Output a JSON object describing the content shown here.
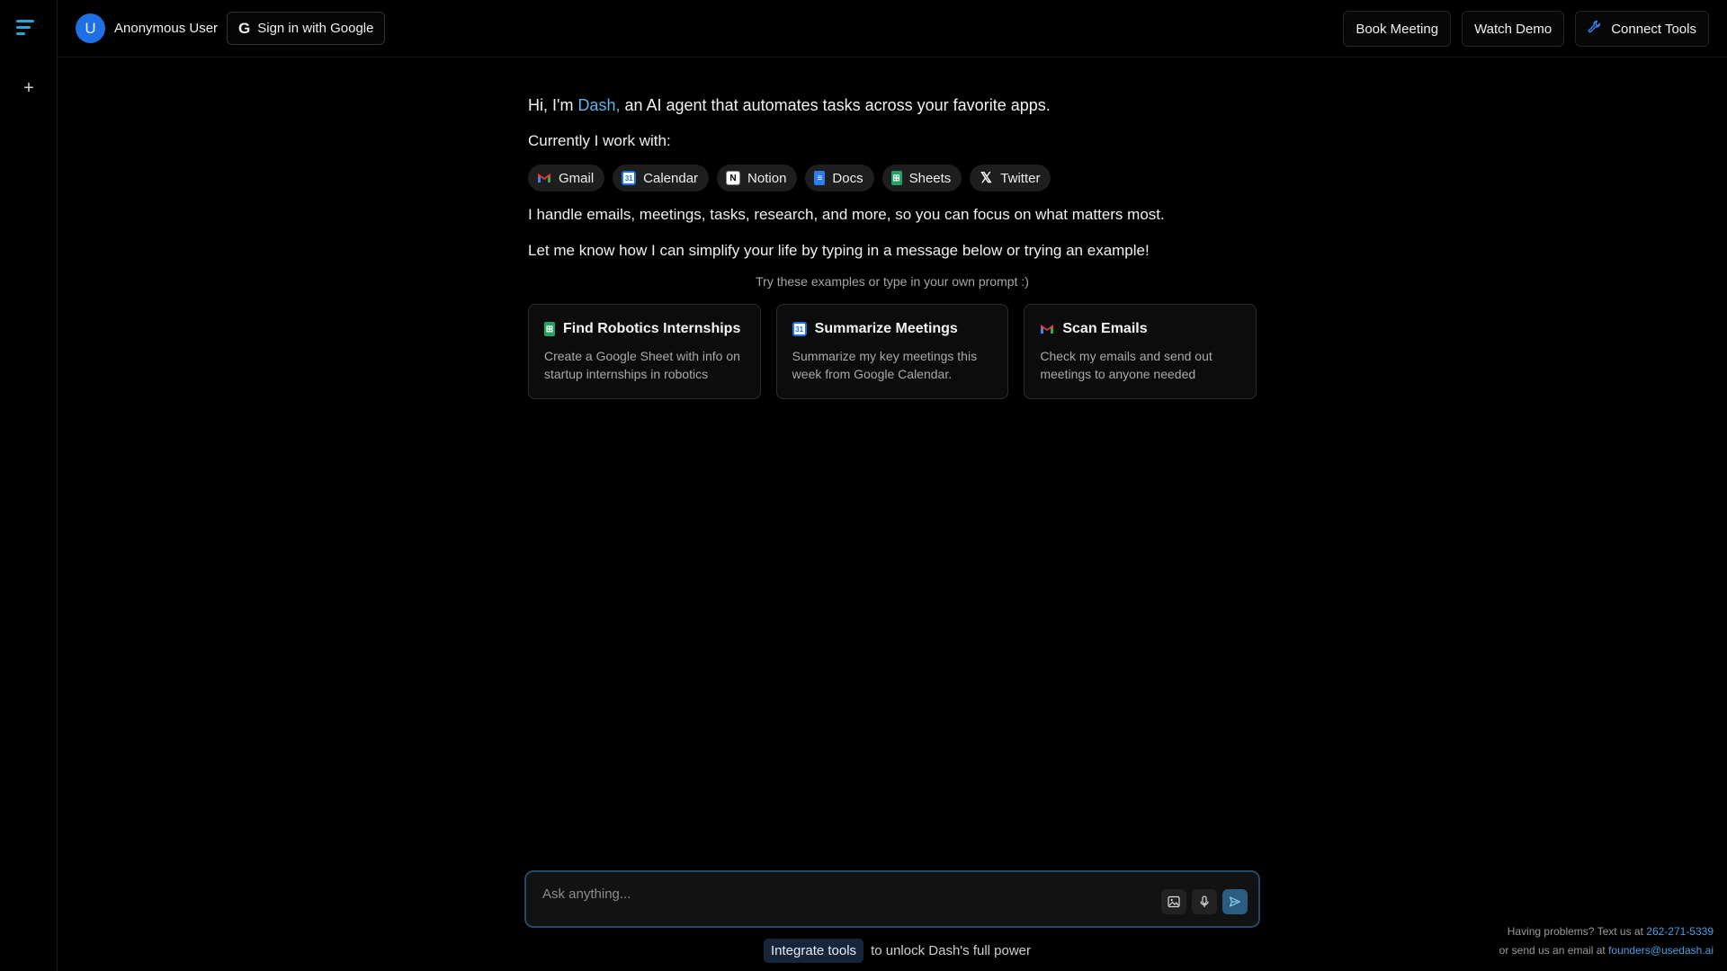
{
  "rail": {
    "plus": "+"
  },
  "user": {
    "initial": "U",
    "name": "Anonymous User"
  },
  "signin": {
    "icon": "G",
    "label": "Sign in with Google"
  },
  "top_buttons": {
    "book": "Book Meeting",
    "demo": "Watch Demo",
    "connect": "Connect Tools"
  },
  "intro": {
    "prefix": "Hi, I'm ",
    "name": "Dash,",
    "suffix": " an AI agent that automates tasks across your favorite apps.",
    "currently": "Currently I work with:",
    "handle": "I handle emails, meetings, tasks, research, and more, so you can focus on what matters most.",
    "letme": "Let me know how I can simplify your life by typing in a message below or trying an example!",
    "try": "Try these examples or type in your own prompt :)"
  },
  "tools": [
    {
      "label": "Gmail",
      "icon": "gmail-icon"
    },
    {
      "label": "Calendar",
      "icon": "calendar-icon"
    },
    {
      "label": "Notion",
      "icon": "notion-icon"
    },
    {
      "label": "Docs",
      "icon": "docs-icon"
    },
    {
      "label": "Sheets",
      "icon": "sheets-icon"
    },
    {
      "label": "Twitter",
      "icon": "x-icon"
    }
  ],
  "examples": [
    {
      "title": "Find Robotics Internships",
      "desc": "Create a Google Sheet with info on startup internships in robotics",
      "icon": "sheets-icon"
    },
    {
      "title": "Summarize Meetings",
      "desc": "Summarize my key meetings this week from Google Calendar.",
      "icon": "calendar-icon"
    },
    {
      "title": "Scan Emails",
      "desc": "Check my emails and send out meetings to anyone needed",
      "icon": "gmail-icon"
    }
  ],
  "prompt": {
    "placeholder": "Ask anything..."
  },
  "integrate": {
    "button": "Integrate tools",
    "text": "to unlock Dash's full power"
  },
  "help": {
    "line1": "Having problems? Text us at ",
    "phone": "262-271-5339",
    "line2": "or send us an email at ",
    "email": "founders@usedash.ai"
  },
  "colors": {
    "accent": "#5fb3e6",
    "avatar": "#1f6fe5",
    "link": "#4a9fe3"
  }
}
